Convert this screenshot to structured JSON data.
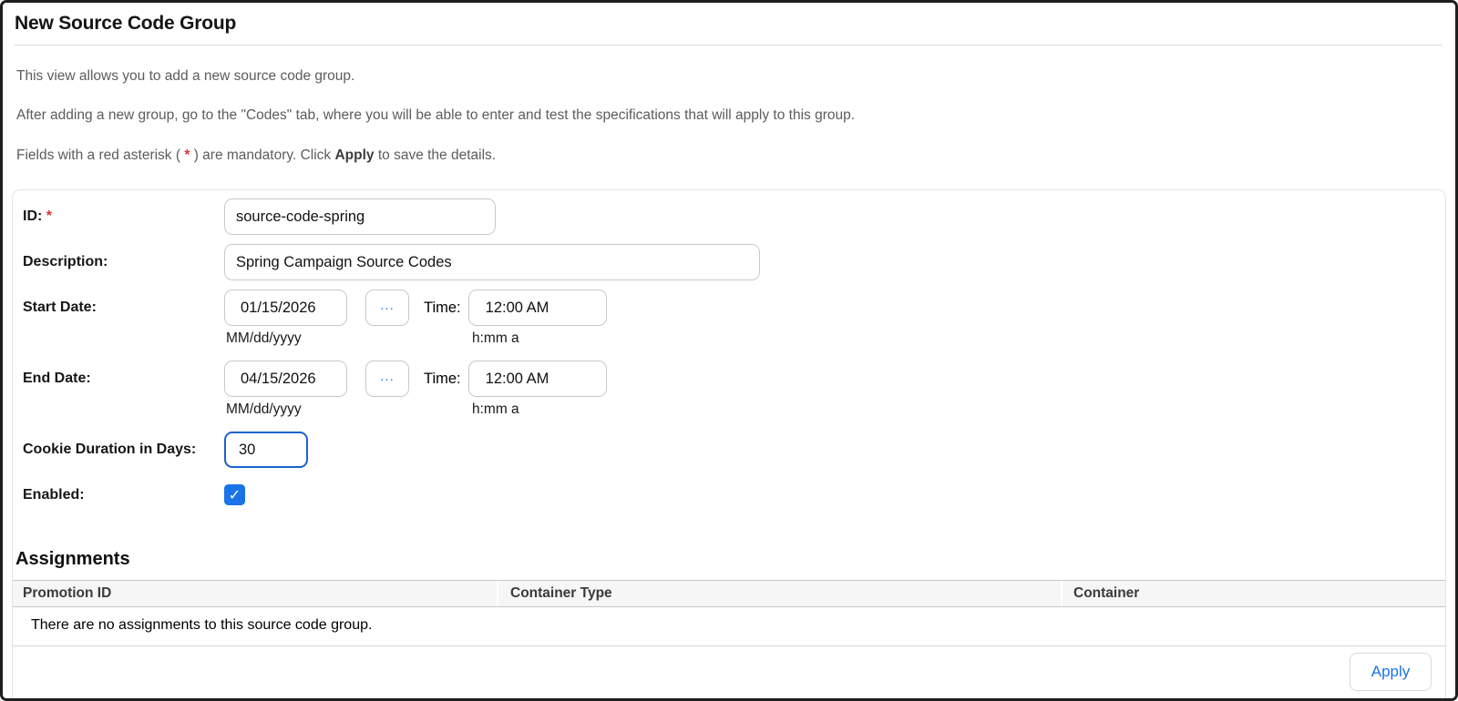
{
  "page": {
    "title": "New Source Code Group"
  },
  "intro": {
    "line1": "This view allows you to add a new source code group.",
    "line2": "After adding a new group, go to the \"Codes\" tab, where you will be able to enter and test the specifications that will apply to this group.",
    "line3_prefix": "Fields with a red asterisk ( ",
    "line3_asterisk": "*",
    "line3_middle": " ) are mandatory. Click ",
    "line3_bold": "Apply",
    "line3_suffix": " to save the details."
  },
  "form": {
    "id": {
      "label": "ID:",
      "required_marker": "*",
      "value": "source-code-spring"
    },
    "description": {
      "label": "Description:",
      "value": "Spring Campaign Source Codes"
    },
    "start_date": {
      "label": "Start Date:",
      "date_value": "01/15/2026",
      "date_hint": "MM/dd/yyyy",
      "picker_label": "...",
      "time_label": "Time:",
      "time_value": "12:00 AM",
      "time_hint": "h:mm a"
    },
    "end_date": {
      "label": "End Date:",
      "date_value": "04/15/2026",
      "date_hint": "MM/dd/yyyy",
      "picker_label": "...",
      "time_label": "Time:",
      "time_value": "12:00 AM",
      "time_hint": "h:mm a"
    },
    "cookie_duration": {
      "label": "Cookie Duration in Days:",
      "value": "30"
    },
    "enabled": {
      "label": "Enabled:",
      "checked": true,
      "glyph": "✓"
    }
  },
  "assignments": {
    "title": "Assignments",
    "columns": [
      "Promotion ID",
      "Container Type",
      "Container"
    ],
    "empty_message": "There are no assignments to this source code group."
  },
  "footer": {
    "apply_label": "Apply"
  },
  "colors": {
    "accent_blue": "#1a73e8",
    "focus_border_blue": "#1b62cf",
    "required_red": "#e03131",
    "table_header_bg": "#f6f6f6",
    "frame_border": "#1f1f1f"
  }
}
